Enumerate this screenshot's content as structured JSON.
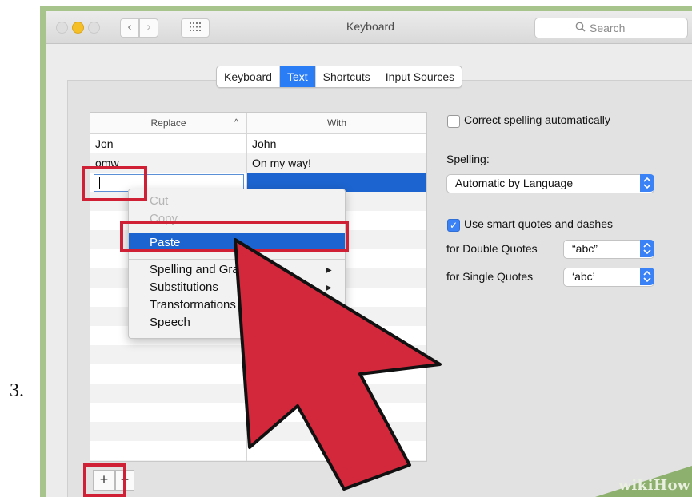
{
  "step_number": "3.",
  "window": {
    "title": "Keyboard",
    "search_placeholder": "Search",
    "nav": {
      "back_glyph": "‹",
      "forward_glyph": "›"
    }
  },
  "tabs": [
    {
      "label": "Keyboard",
      "active": false
    },
    {
      "label": "Text",
      "active": true
    },
    {
      "label": "Shortcuts",
      "active": false
    },
    {
      "label": "Input Sources",
      "active": false
    }
  ],
  "table": {
    "headers": {
      "replace": "Replace",
      "with": "With"
    },
    "rows": [
      {
        "replace": "Jon",
        "with": "John"
      },
      {
        "replace": "omw",
        "with": "On my way!"
      }
    ]
  },
  "context_menu": {
    "items": [
      {
        "label": "Cut",
        "disabled": true
      },
      {
        "label": "Copy",
        "disabled": true
      },
      {
        "label": "Paste",
        "highlighted": true
      },
      {
        "label": "Spelling and Grammar",
        "submenu": true
      },
      {
        "label": "Substitutions",
        "submenu": true
      },
      {
        "label": "Transformations",
        "submenu": true
      },
      {
        "label": "Speech",
        "submenu": true
      }
    ]
  },
  "settings": {
    "correct_spelling_label": "Correct spelling automatically",
    "correct_spelling_checked": false,
    "spelling_label": "Spelling:",
    "spelling_value": "Automatic by Language",
    "smart_quotes_label": "Use smart quotes and dashes",
    "smart_quotes_checked": true,
    "double_quotes_label": "for Double Quotes",
    "double_quotes_value": "“abc”",
    "single_quotes_label": "for Single Quotes",
    "single_quotes_value": "‘abc’"
  },
  "buttons": {
    "add": "+",
    "remove": "−"
  },
  "watermark": "wikiHow",
  "colors": {
    "highlight": "#1c64cf",
    "annotation_red": "#cf2035",
    "accent": "#2b7df6"
  }
}
